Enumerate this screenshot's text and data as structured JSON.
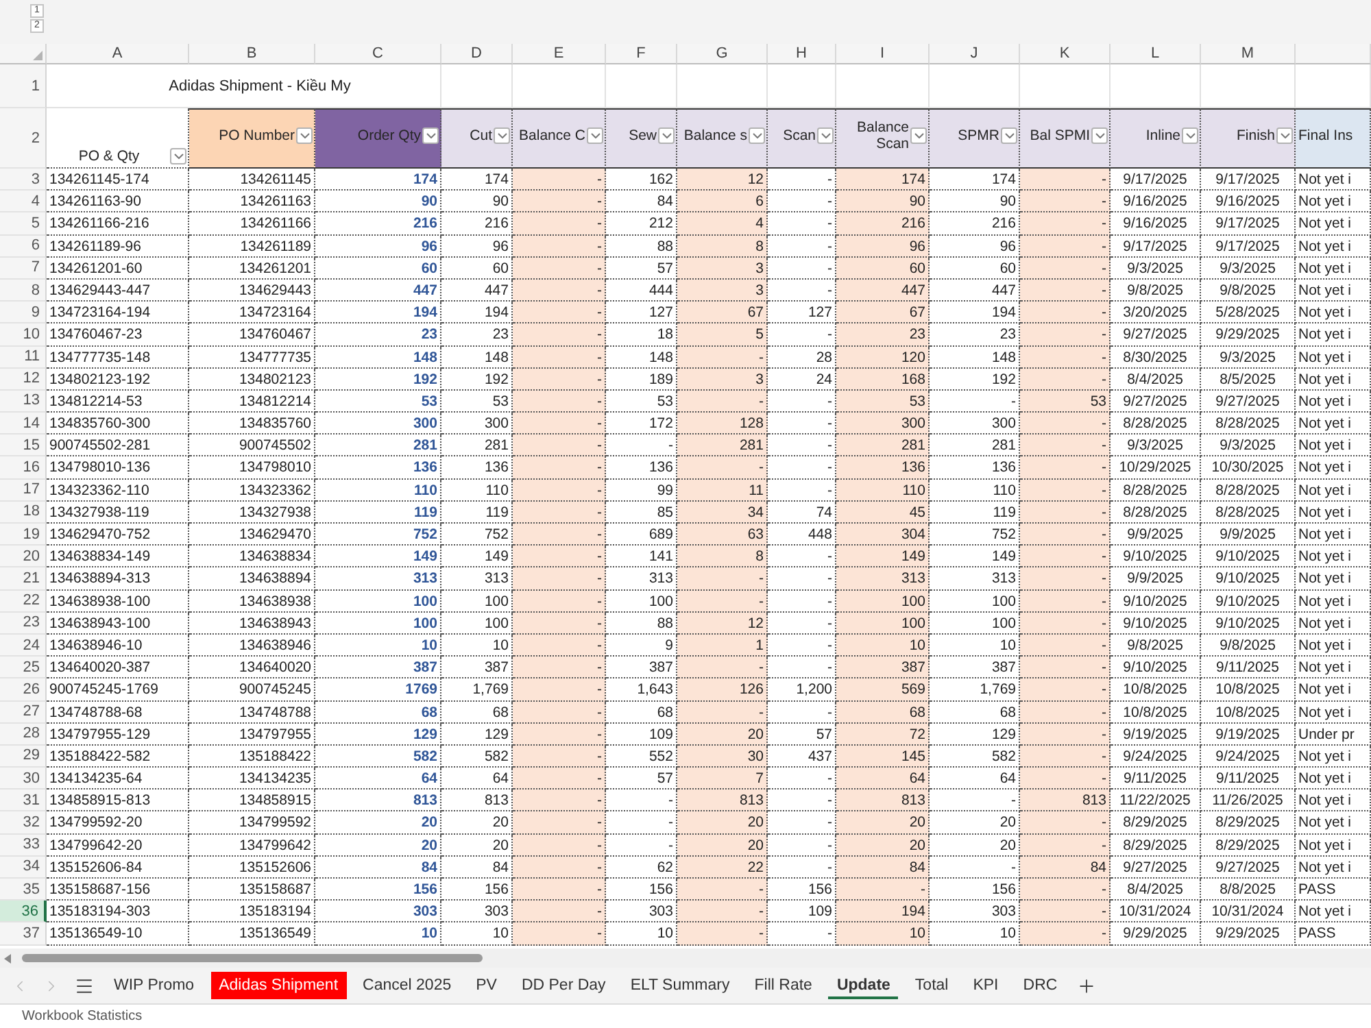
{
  "outline_buttons": [
    "1",
    "2"
  ],
  "title_row": {
    "number": "1",
    "text": "Adidas Shipment - Kiều My"
  },
  "header_row_number": "2",
  "columns": [
    {
      "letter": "A",
      "label": "PO & Qty",
      "kind": "text",
      "filter": true
    },
    {
      "letter": "B",
      "label": "PO Number",
      "kind": "number",
      "color": "#fcd5b4",
      "filter": true
    },
    {
      "letter": "C",
      "label": "Order Qty",
      "kind": "quantity",
      "color": "#8064a2",
      "filter": true
    },
    {
      "letter": "D",
      "label": "Cut",
      "kind": "number",
      "color": "#e4dfec",
      "filter": true
    },
    {
      "letter": "E",
      "label": "Balance C",
      "kind": "balance",
      "color": "#e4dfec",
      "filter": true
    },
    {
      "letter": "F",
      "label": "Sew",
      "kind": "number",
      "color": "#e4dfec",
      "filter": true
    },
    {
      "letter": "G",
      "label": "Balance s",
      "kind": "balance",
      "color": "#e4dfec",
      "filter": true
    },
    {
      "letter": "H",
      "label": "Scan",
      "kind": "number",
      "color": "#e4dfec",
      "filter": true
    },
    {
      "letter": "I",
      "label": "Balance Scan",
      "kind": "balance",
      "color": "#e4dfec",
      "filter": true
    },
    {
      "letter": "J",
      "label": "SPMR",
      "kind": "number",
      "color": "#e4dfec",
      "filter": true
    },
    {
      "letter": "K",
      "label": "Bal SPMI",
      "kind": "balance",
      "color": "#e4dfec",
      "filter": true
    },
    {
      "letter": "L",
      "label": "Inline",
      "kind": "date",
      "color": "#e4dfec",
      "filter": true
    },
    {
      "letter": "M",
      "label": "Finish",
      "kind": "date",
      "color": "#e4dfec",
      "filter": true
    },
    {
      "label": "Final Ins",
      "kind": "status",
      "color": "#dce6f1",
      "filter": false
    }
  ],
  "rows": [
    {
      "number": "3",
      "selected": false,
      "cells": [
        "134261145-174",
        "134261145",
        "174",
        "174",
        "-",
        "162",
        "12",
        "-",
        "174",
        "174",
        "-",
        "9/17/2025",
        "9/17/2025",
        "Not yet i"
      ]
    },
    {
      "number": "4",
      "selected": false,
      "cells": [
        "134261163-90",
        "134261163",
        "90",
        "90",
        "-",
        "84",
        "6",
        "-",
        "90",
        "90",
        "-",
        "9/16/2025",
        "9/16/2025",
        "Not yet i"
      ]
    },
    {
      "number": "5",
      "selected": false,
      "cells": [
        "134261166-216",
        "134261166",
        "216",
        "216",
        "-",
        "212",
        "4",
        "-",
        "216",
        "216",
        "-",
        "9/16/2025",
        "9/17/2025",
        "Not yet i"
      ]
    },
    {
      "number": "6",
      "selected": false,
      "cells": [
        "134261189-96",
        "134261189",
        "96",
        "96",
        "-",
        "88",
        "8",
        "-",
        "96",
        "96",
        "-",
        "9/17/2025",
        "9/17/2025",
        "Not yet i"
      ]
    },
    {
      "number": "7",
      "selected": false,
      "cells": [
        "134261201-60",
        "134261201",
        "60",
        "60",
        "-",
        "57",
        "3",
        "-",
        "60",
        "60",
        "-",
        "9/3/2025",
        "9/3/2025",
        "Not yet i"
      ]
    },
    {
      "number": "8",
      "selected": false,
      "cells": [
        "134629443-447",
        "134629443",
        "447",
        "447",
        "-",
        "444",
        "3",
        "-",
        "447",
        "447",
        "-",
        "9/8/2025",
        "9/8/2025",
        "Not yet i"
      ]
    },
    {
      "number": "9",
      "selected": false,
      "cells": [
        "134723164-194",
        "134723164",
        "194",
        "194",
        "-",
        "127",
        "67",
        "127",
        "67",
        "194",
        "-",
        "3/20/2025",
        "5/28/2025",
        "Not yet i"
      ]
    },
    {
      "number": "10",
      "selected": false,
      "cells": [
        "134760467-23",
        "134760467",
        "23",
        "23",
        "-",
        "18",
        "5",
        "-",
        "23",
        "23",
        "-",
        "9/27/2025",
        "9/29/2025",
        "Not yet i"
      ]
    },
    {
      "number": "11",
      "selected": false,
      "cells": [
        "134777735-148",
        "134777735",
        "148",
        "148",
        "-",
        "148",
        "-",
        "28",
        "120",
        "148",
        "-",
        "8/30/2025",
        "9/3/2025",
        "Not yet i"
      ]
    },
    {
      "number": "12",
      "selected": false,
      "cells": [
        "134802123-192",
        "134802123",
        "192",
        "192",
        "-",
        "189",
        "3",
        "24",
        "168",
        "192",
        "-",
        "8/4/2025",
        "8/5/2025",
        "Not yet i"
      ]
    },
    {
      "number": "13",
      "selected": false,
      "cells": [
        "134812214-53",
        "134812214",
        "53",
        "53",
        "-",
        "53",
        "-",
        "-",
        "53",
        "-",
        "53",
        "9/27/2025",
        "9/27/2025",
        "Not yet i"
      ]
    },
    {
      "number": "14",
      "selected": false,
      "cells": [
        "134835760-300",
        "134835760",
        "300",
        "300",
        "-",
        "172",
        "128",
        "-",
        "300",
        "300",
        "-",
        "8/28/2025",
        "8/28/2025",
        "Not yet i"
      ]
    },
    {
      "number": "15",
      "selected": false,
      "cells": [
        "900745502-281",
        "900745502",
        "281",
        "281",
        "-",
        "-",
        "281",
        "-",
        "281",
        "281",
        "-",
        "9/3/2025",
        "9/3/2025",
        "Not yet i"
      ]
    },
    {
      "number": "16",
      "selected": false,
      "cells": [
        "134798010-136",
        "134798010",
        "136",
        "136",
        "-",
        "136",
        "-",
        "-",
        "136",
        "136",
        "-",
        "10/29/2025",
        "10/30/2025",
        "Not yet i"
      ]
    },
    {
      "number": "17",
      "selected": false,
      "cells": [
        "134323362-110",
        "134323362",
        "110",
        "110",
        "-",
        "99",
        "11",
        "-",
        "110",
        "110",
        "-",
        "8/28/2025",
        "8/28/2025",
        "Not yet i"
      ]
    },
    {
      "number": "18",
      "selected": false,
      "cells": [
        "134327938-119",
        "134327938",
        "119",
        "119",
        "-",
        "85",
        "34",
        "74",
        "45",
        "119",
        "-",
        "8/28/2025",
        "8/28/2025",
        "Not yet i"
      ]
    },
    {
      "number": "19",
      "selected": false,
      "cells": [
        "134629470-752",
        "134629470",
        "752",
        "752",
        "-",
        "689",
        "63",
        "448",
        "304",
        "752",
        "-",
        "9/9/2025",
        "9/9/2025",
        "Not yet i"
      ]
    },
    {
      "number": "20",
      "selected": false,
      "cells": [
        "134638834-149",
        "134638834",
        "149",
        "149",
        "-",
        "141",
        "8",
        "-",
        "149",
        "149",
        "-",
        "9/10/2025",
        "9/10/2025",
        "Not yet i"
      ]
    },
    {
      "number": "21",
      "selected": false,
      "cells": [
        "134638894-313",
        "134638894",
        "313",
        "313",
        "-",
        "313",
        "-",
        "-",
        "313",
        "313",
        "-",
        "9/9/2025",
        "9/10/2025",
        "Not yet i"
      ]
    },
    {
      "number": "22",
      "selected": false,
      "cells": [
        "134638938-100",
        "134638938",
        "100",
        "100",
        "-",
        "100",
        "-",
        "-",
        "100",
        "100",
        "-",
        "9/10/2025",
        "9/10/2025",
        "Not yet i"
      ]
    },
    {
      "number": "23",
      "selected": false,
      "cells": [
        "134638943-100",
        "134638943",
        "100",
        "100",
        "-",
        "88",
        "12",
        "-",
        "100",
        "100",
        "-",
        "9/10/2025",
        "9/10/2025",
        "Not yet i"
      ]
    },
    {
      "number": "24",
      "selected": false,
      "cells": [
        "134638946-10",
        "134638946",
        "10",
        "10",
        "-",
        "9",
        "1",
        "-",
        "10",
        "10",
        "-",
        "9/8/2025",
        "9/8/2025",
        "Not yet i"
      ]
    },
    {
      "number": "25",
      "selected": false,
      "cells": [
        "134640020-387",
        "134640020",
        "387",
        "387",
        "-",
        "387",
        "-",
        "-",
        "387",
        "387",
        "-",
        "9/10/2025",
        "9/11/2025",
        "Not yet i"
      ]
    },
    {
      "number": "26",
      "selected": false,
      "cells": [
        "900745245-1769",
        "900745245",
        "1769",
        "1,769",
        "-",
        "1,643",
        "126",
        "1,200",
        "569",
        "1,769",
        "-",
        "10/8/2025",
        "10/8/2025",
        "Not yet i"
      ]
    },
    {
      "number": "27",
      "selected": false,
      "cells": [
        "134748788-68",
        "134748788",
        "68",
        "68",
        "-",
        "68",
        "-",
        "-",
        "68",
        "68",
        "-",
        "10/8/2025",
        "10/8/2025",
        "Not yet i"
      ]
    },
    {
      "number": "28",
      "selected": false,
      "cells": [
        "134797955-129",
        "134797955",
        "129",
        "129",
        "-",
        "109",
        "20",
        "57",
        "72",
        "129",
        "-",
        "9/19/2025",
        "9/19/2025",
        "Under pr"
      ]
    },
    {
      "number": "29",
      "selected": false,
      "cells": [
        "135188422-582",
        "135188422",
        "582",
        "582",
        "-",
        "552",
        "30",
        "437",
        "145",
        "582",
        "-",
        "9/24/2025",
        "9/24/2025",
        "Not yet i"
      ]
    },
    {
      "number": "30",
      "selected": false,
      "cells": [
        "134134235-64",
        "134134235",
        "64",
        "64",
        "-",
        "57",
        "7",
        "-",
        "64",
        "64",
        "-",
        "9/11/2025",
        "9/11/2025",
        "Not yet i"
      ]
    },
    {
      "number": "31",
      "selected": false,
      "cells": [
        "134858915-813",
        "134858915",
        "813",
        "813",
        "-",
        "-",
        "813",
        "-",
        "813",
        "-",
        "813",
        "11/22/2025",
        "11/26/2025",
        "Not yet i"
      ]
    },
    {
      "number": "32",
      "selected": false,
      "cells": [
        "134799592-20",
        "134799592",
        "20",
        "20",
        "-",
        "-",
        "20",
        "-",
        "20",
        "20",
        "-",
        "8/29/2025",
        "8/29/2025",
        "Not yet i"
      ]
    },
    {
      "number": "33",
      "selected": false,
      "cells": [
        "134799642-20",
        "134799642",
        "20",
        "20",
        "-",
        "-",
        "20",
        "-",
        "20",
        "20",
        "-",
        "8/29/2025",
        "8/29/2025",
        "Not yet i"
      ]
    },
    {
      "number": "34",
      "selected": false,
      "cells": [
        "135152606-84",
        "135152606",
        "84",
        "84",
        "-",
        "62",
        "22",
        "-",
        "84",
        "-",
        "84",
        "9/27/2025",
        "9/27/2025",
        "Not yet i"
      ]
    },
    {
      "number": "35",
      "selected": false,
      "cells": [
        "135158687-156",
        "135158687",
        "156",
        "156",
        "-",
        "156",
        "-",
        "156",
        "-",
        "156",
        "-",
        "8/4/2025",
        "8/8/2025",
        "PASS"
      ]
    },
    {
      "number": "36",
      "selected": true,
      "cells": [
        "135183194-303",
        "135183194",
        "303",
        "303",
        "-",
        "303",
        "-",
        "109",
        "194",
        "303",
        "-",
        "10/31/2024",
        "10/31/2024",
        "Not yet i"
      ]
    },
    {
      "number": "37",
      "selected": false,
      "cells": [
        "135136549-10",
        "135136549",
        "10",
        "10",
        "-",
        "10",
        "-",
        "-",
        "10",
        "10",
        "-",
        "9/29/2025",
        "9/29/2025",
        "PASS"
      ]
    }
  ],
  "sheet_tabs": [
    {
      "label": "WIP Promo",
      "selected": false
    },
    {
      "label": "Adidas Shipment",
      "selected": false,
      "color": "#ff0000"
    },
    {
      "label": "Cancel 2025",
      "selected": false
    },
    {
      "label": "PV",
      "selected": false
    },
    {
      "label": "DD Per Day",
      "selected": false
    },
    {
      "label": "ELT Summary",
      "selected": false
    },
    {
      "label": "Fill Rate",
      "selected": false
    },
    {
      "label": "Update",
      "selected": true
    },
    {
      "label": "Total",
      "selected": false
    },
    {
      "label": "KPI",
      "selected": false
    },
    {
      "label": "DRC",
      "selected": false
    }
  ],
  "status_bar": "Workbook Statistics"
}
